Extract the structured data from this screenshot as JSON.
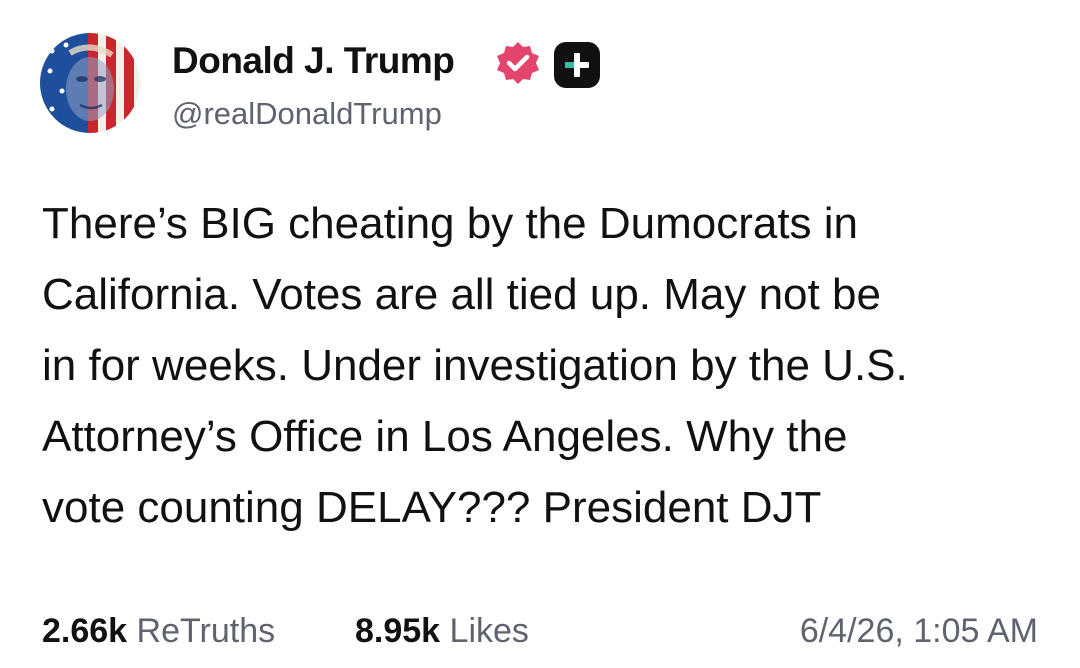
{
  "author": {
    "display_name": "Donald J. Trump",
    "handle": "@realDonaldTrump",
    "verified_color": "#e5446d"
  },
  "post": {
    "lines": [
      "There’s BIG cheating by the Dumocrats in",
      "California. Votes are all tied up. May not be",
      "in for weeks. Under investigation by the U.S.",
      "Attorney’s Office in Los Angeles. Why the",
      "vote counting DELAY??? President DJT"
    ]
  },
  "stats": {
    "retruths_count": "2.66k",
    "retruths_label": "ReTruths",
    "likes_count": "8.95k",
    "likes_label": "Likes",
    "timestamp": "6/4/26, 1:05 AM"
  },
  "icons": {
    "verified": "verified-badge-icon",
    "plus": "plus-badge-icon"
  }
}
